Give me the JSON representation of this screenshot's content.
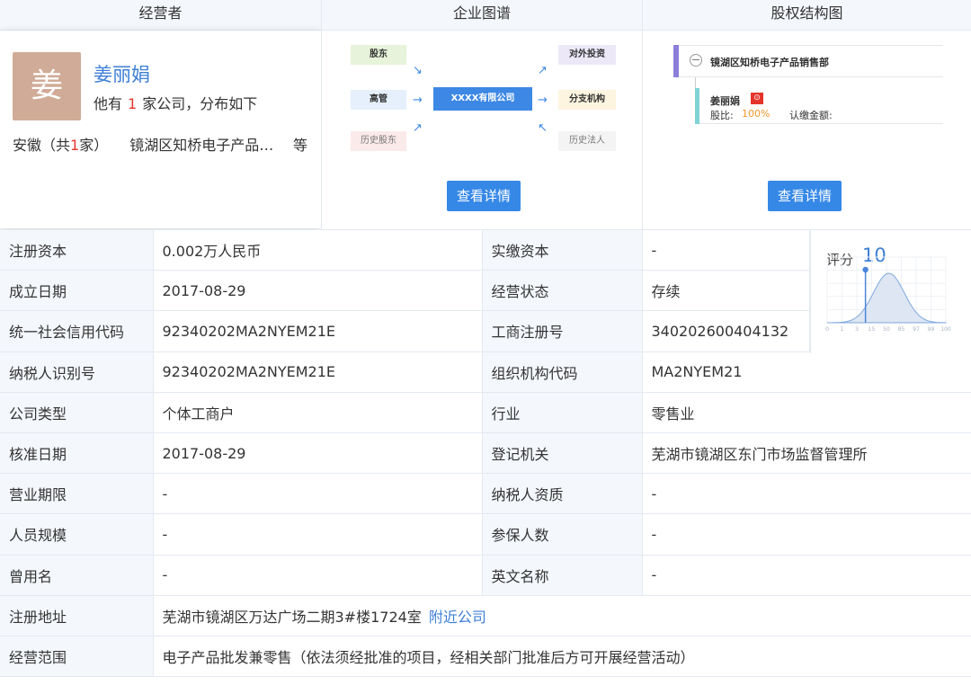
{
  "header": {
    "operator": "经营者",
    "enterprise_graph": "企业图谱",
    "equity": "股权结构图"
  },
  "operator": {
    "avatar_char": "姜",
    "name": "姜丽娟",
    "desc_prefix": "他有",
    "count": "1",
    "desc_suffix": "家公司，分布如下",
    "region_prefix": "安徽（共",
    "region_count": "1",
    "region_suffix": "家）",
    "region_company": "镜湖区知桥电子产品…",
    "more": "等"
  },
  "graph": {
    "nodes": {
      "shareholder": "股东",
      "executive": "高管",
      "history_shareholder": "历史股东",
      "center": "XXXX有限公司",
      "investment": "对外投资",
      "branch": "分支机构",
      "history_legal": "历史法人"
    },
    "details_button": "查看详情"
  },
  "equity": {
    "company": "镜湖区知桥电子产品销售部",
    "person": "姜丽娟",
    "ratio_label": "股比:",
    "ratio_value": "100%",
    "amount_label": "认缴金额:",
    "details_button": "查看详情"
  },
  "score": {
    "label": "评分",
    "value": "10",
    "ticks": [
      "0",
      "1",
      "3",
      "15",
      "50",
      "85",
      "97",
      "99",
      "100"
    ]
  },
  "rows": [
    {
      "l1": "注册资本",
      "v1": "0.002万人民币",
      "l2": "实缴资本",
      "v2": "-"
    },
    {
      "l1": "成立日期",
      "v1": "2017-08-29",
      "l2": "经营状态",
      "v2": "存续"
    },
    {
      "l1": "统一社会信用代码",
      "v1": "92340202MA2NYEM21E",
      "l2": "工商注册号",
      "v2": "340202600404132"
    },
    {
      "l1": "纳税人识别号",
      "v1": "92340202MA2NYEM21E",
      "l2": "组织机构代码",
      "v2": "MA2NYEM21"
    },
    {
      "l1": "公司类型",
      "v1": "个体工商户",
      "l2": "行业",
      "v2": "零售业"
    },
    {
      "l1": "核准日期",
      "v1": "2017-08-29",
      "l2": "登记机关",
      "v2": "芜湖市镜湖区东门市场监督管理所"
    },
    {
      "l1": "营业期限",
      "v1": "-",
      "l2": "纳税人资质",
      "v2": "-"
    },
    {
      "l1": "人员规模",
      "v1": "-",
      "l2": "参保人数",
      "v2": "-"
    },
    {
      "l1": "曾用名",
      "v1": "-",
      "l2": "英文名称",
      "v2": "-"
    }
  ],
  "address": {
    "label": "注册地址",
    "value": "芜湖市镜湖区万达广场二期3#楼1724室",
    "link": "附近公司"
  },
  "scope": {
    "label": "经营范围",
    "value": "电子产品批发兼零售（依法须经批准的项目，经相关部门批准后方可开展经营活动）"
  }
}
